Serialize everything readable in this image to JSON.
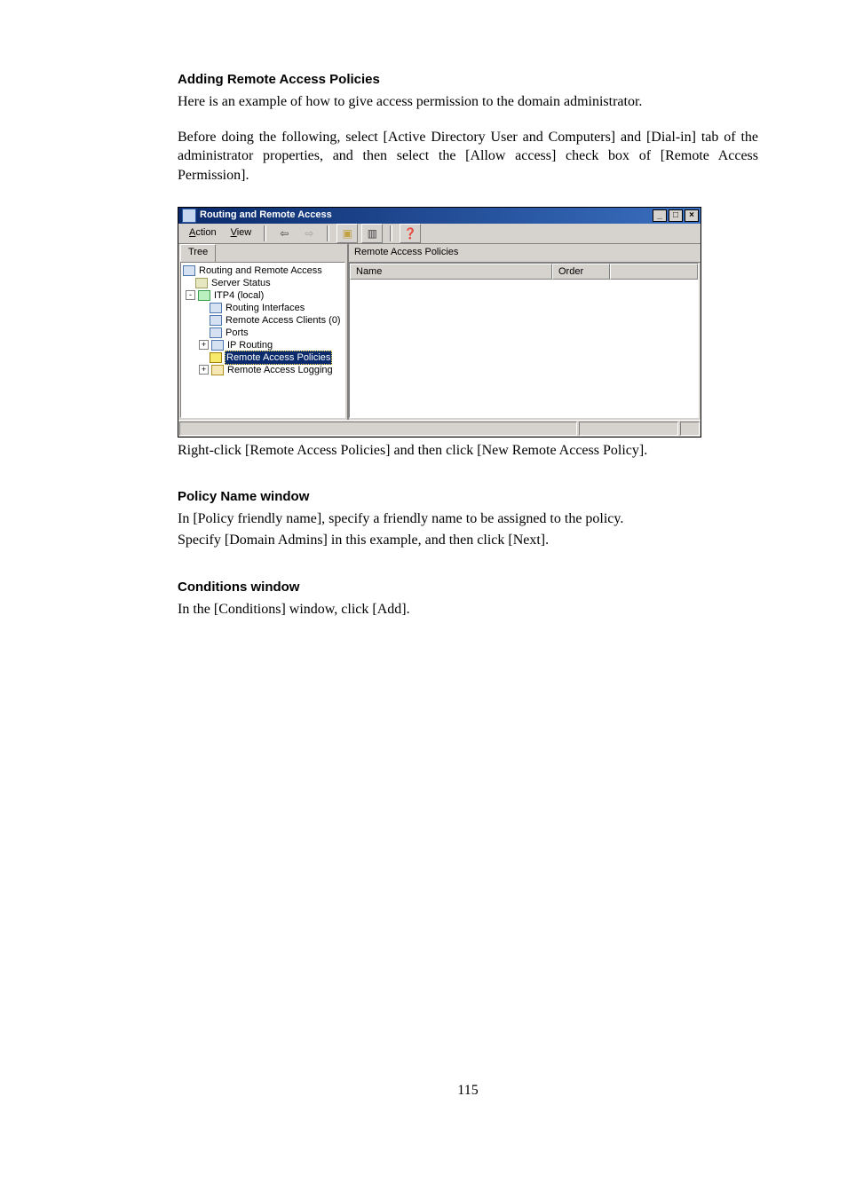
{
  "doc": {
    "h1": "Adding Remote Access Policies",
    "p1": "Here is an example of how to give access permission to the domain administrator.",
    "p2": "Before doing the following, select [Active Directory User and Computers] and [Dial-in] tab of the administrator properties, and then select the [Allow access] check box of [Remote Access Permission].",
    "caption1": "Right-click [Remote Access Policies] and then click [New Remote Access Policy].",
    "h2": "Policy Name window",
    "p3": "In [Policy friendly name], specify a friendly name to be assigned to the policy.",
    "p4": "Specify [Domain Admins] in this example, and then click [Next].",
    "h3": "Conditions window",
    "p5": "In the [Conditions] window, click [Add].",
    "page_number": "115"
  },
  "win": {
    "title": "Routing and Remote Access",
    "menu": {
      "action_letter": "A",
      "action_rest": "ction",
      "view_letter": "V",
      "view_rest": "iew"
    },
    "left_tab": "Tree",
    "right_title": "Remote Access Policies",
    "cols": {
      "name": "Name",
      "order": "Order"
    },
    "tree": {
      "root": "Routing and Remote Access",
      "server_status": "Server Status",
      "local": "ITP4 (local)",
      "routing_interfaces": "Routing Interfaces",
      "remote_access_clients": "Remote Access Clients (0)",
      "ports": "Ports",
      "ip_routing": "IP Routing",
      "remote_access_policies": "Remote Access Policies",
      "remote_access_logging": "Remote Access Logging"
    },
    "btn": {
      "min": "_",
      "max": "□",
      "close": "×",
      "back": "⇦",
      "fwd": "⇨",
      "up": "▣",
      "props": "▥",
      "help": "❓"
    }
  }
}
